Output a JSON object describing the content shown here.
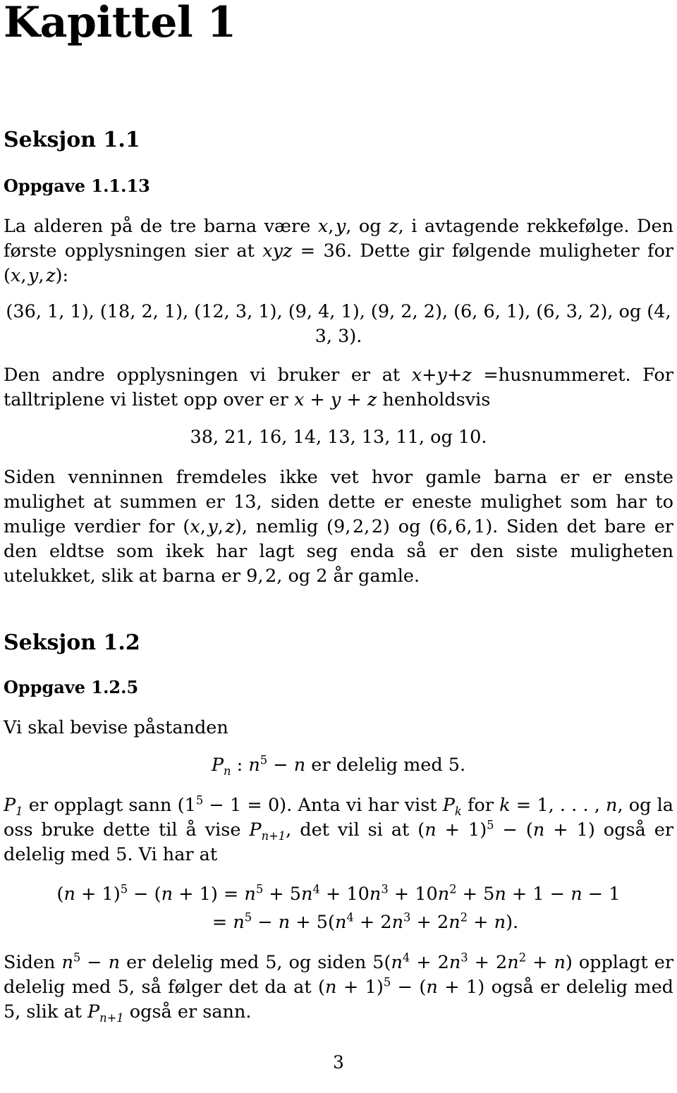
{
  "document": {
    "language": "Norwegian",
    "chapter_title": "Kapittel 1",
    "page_number": "3"
  },
  "sections": {
    "section_1_1": {
      "heading": "Seksjon 1.1",
      "exercise_heading": "Oppgave 1.1.13",
      "para1_line1": "La alderen på de tre barna være x, y, og z, i avtagende rekkefølge. Den første",
      "para1_line2": "opplysningen sier at xyz = 36. Dette gir følgende muligheter for (x, y, z):",
      "triples_display": "(36, 1, 1), (18, 2, 1), (12, 3, 1), (9, 4, 1), (9, 2, 2), (6, 6, 1), (6, 3, 2), og (4, 3, 3).",
      "triples_list": [
        "(36, 1, 1)",
        "(18, 2, 1)",
        "(12, 3, 1)",
        "(9, 4, 1)",
        "(9, 2, 2)",
        "(6, 6, 1)",
        "(6, 3, 2)",
        "(4, 3, 3)"
      ],
      "para2_line1": "Den andre opplysningen vi bruker er at x+y+z =husnummeret. For talltriplene",
      "para2_line2": "vi listet opp over er x + y + z henholdsvis",
      "sums_display": "38, 21, 16, 14, 13, 13, 11, og 10.",
      "sums_list": [
        "38",
        "21",
        "16",
        "14",
        "13",
        "13",
        "11",
        "10"
      ],
      "para3_line1": "Siden venninnen fremdeles ikke vet hvor gamle barna er er enste mulighet at",
      "para3_line2": "summen er 13, siden dette er eneste mulighet som har to mulige verdier for",
      "para3_line3": "(x, y, z), nemlig (9, 2, 2) og (6, 6, 1). Siden det bare er den eldtse som ikek har",
      "para3_line4": "lagt seg enda så er den siste muligheten utelukket, slik at barna er 9, 2, og 2 år",
      "para3_line5": "gamle."
    },
    "section_1_2": {
      "heading": "Seksjon 1.2",
      "exercise_heading": "Oppgave 1.2.5",
      "intro": "Vi skal bevise påstanden",
      "claim_display": "Pn : n5 − n er delelig med 5.",
      "para1_line1": "P1 er opplagt sann (15 − 1 = 0). Anta vi har vist Pk for k = 1, . . . , n, og la oss",
      "para1_line2": "bruke dette til å vise Pn+1, det vil si at (n + 1)5 − (n + 1) også er delelig med",
      "para1_line3": "5. Vi har at",
      "equation_line1": "(n + 1)5 − (n + 1) = n5 + 5n4 + 10n3 + 10n2 + 5n + 1 − n − 1",
      "equation_line2": "= n5 − n + 5(n4 + 2n3 + 2n2 + n).",
      "para2_line1": "Siden n5 − n er delelig med 5, og siden 5(n4 + 2n3 + 2n2 + n) opplagt er delelig",
      "para2_line2": "med 5, så følger det da at (n + 1)5 − (n + 1) også er delelig med 5, slik at Pn+1",
      "para2_line3": "også er sann."
    }
  }
}
